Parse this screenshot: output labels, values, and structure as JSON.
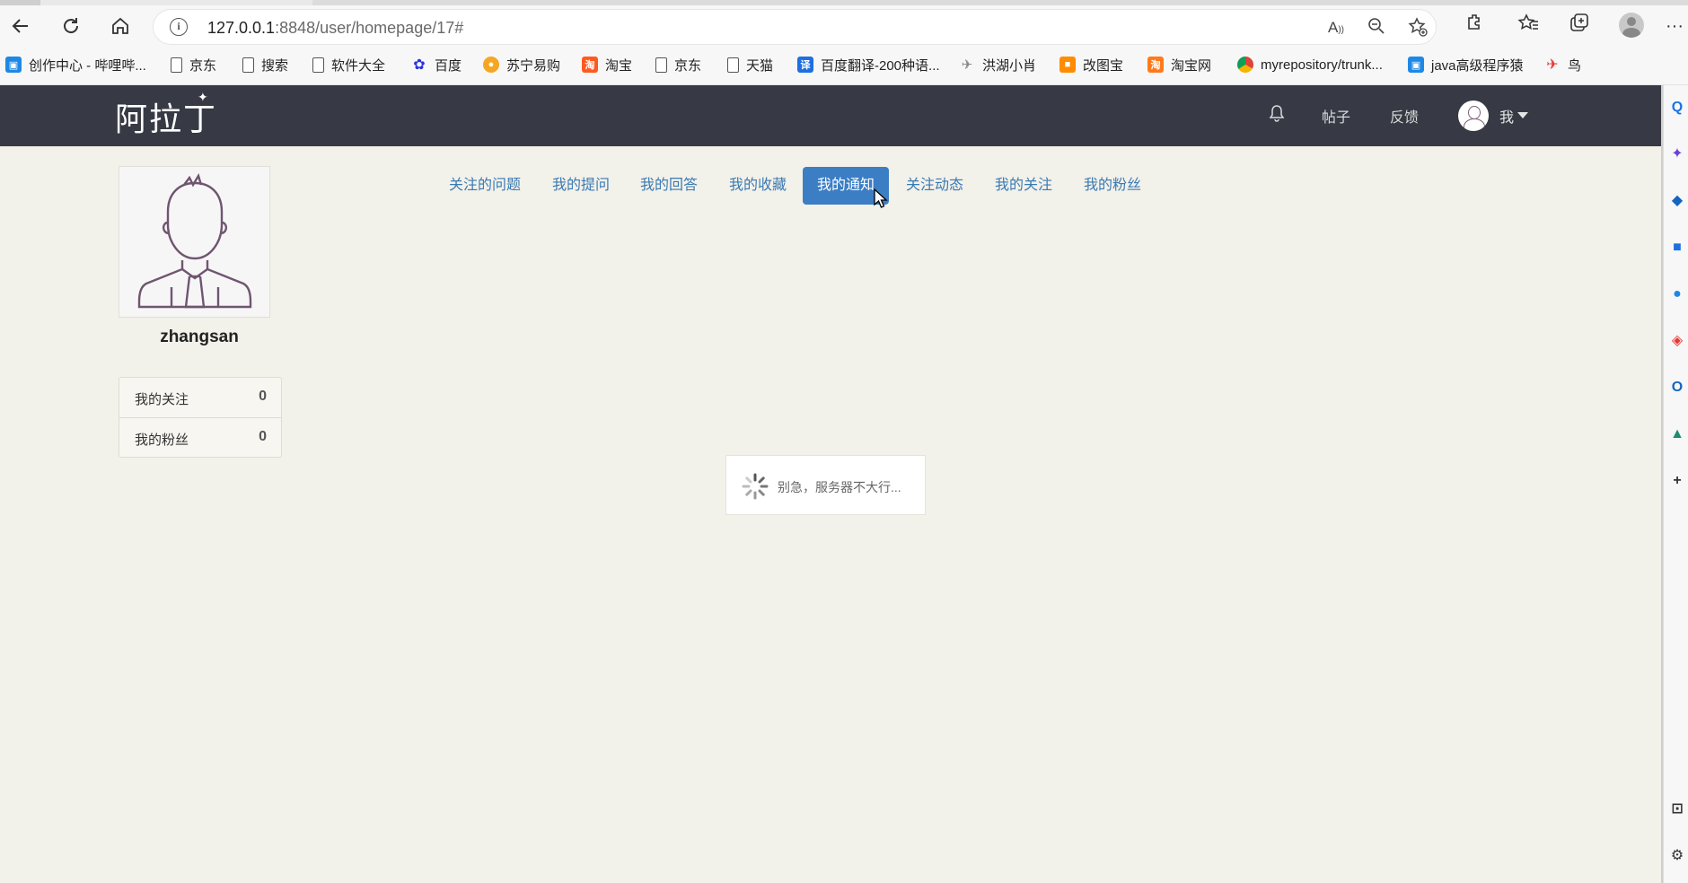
{
  "browser": {
    "url_host": "127.0.0.1",
    "url_rest": ":8848/user/homepage/17#",
    "bookmarks": [
      {
        "label": "创作中心 - 哔哩哔...",
        "icon": "bilibili-icon"
      },
      {
        "label": "京东",
        "icon": "page-icon"
      },
      {
        "label": "搜索",
        "icon": "page-icon"
      },
      {
        "label": "软件大全",
        "icon": "page-icon"
      },
      {
        "label": "百度",
        "icon": "baidu-icon"
      },
      {
        "label": "苏宁易购",
        "icon": "suning-icon"
      },
      {
        "label": "淘宝",
        "icon": "taobao-icon"
      },
      {
        "label": "京东",
        "icon": "page-icon"
      },
      {
        "label": "天猫",
        "icon": "page-icon"
      },
      {
        "label": "百度翻译-200种语...",
        "icon": "translate-icon"
      },
      {
        "label": "洪湖小肖",
        "icon": "bird-icon"
      },
      {
        "label": "改图宝",
        "icon": "gaitubao-icon"
      },
      {
        "label": "淘宝网",
        "icon": "taobao-icon"
      },
      {
        "label": "myrepository/trunk...",
        "icon": "chrome-icon"
      },
      {
        "label": "java高级程序猿",
        "icon": "bilibili-icon"
      },
      {
        "label": "鸟",
        "icon": "bird-red-icon"
      }
    ]
  },
  "site": {
    "logo": "阿拉丁",
    "nav": {
      "posts": "帖子",
      "feedback": "反馈",
      "me": "我"
    }
  },
  "profile": {
    "username": "zhangsan",
    "stats": [
      {
        "label": "我的关注",
        "count": "0"
      },
      {
        "label": "我的粉丝",
        "count": "0"
      }
    ]
  },
  "tabs": [
    {
      "label": "关注的问题",
      "active": false
    },
    {
      "label": "我的提问",
      "active": false
    },
    {
      "label": "我的回答",
      "active": false
    },
    {
      "label": "我的收藏",
      "active": false
    },
    {
      "label": "我的通知",
      "active": true
    },
    {
      "label": "关注动态",
      "active": false
    },
    {
      "label": "我的关注",
      "active": false
    },
    {
      "label": "我的粉丝",
      "active": false
    }
  ],
  "loading": {
    "text": "别急，服务器不大行..."
  },
  "colors": {
    "header_bg": "#373a45",
    "page_bg": "#f2f1ea",
    "tab_text": "#3a7ab3",
    "tab_active_bg": "#3b7ec4"
  }
}
